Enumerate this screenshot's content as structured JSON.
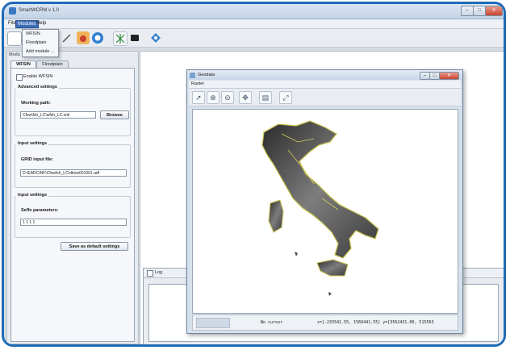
{
  "window": {
    "title": "SmartWCRM v 1.0"
  },
  "menubar": {
    "items": [
      "File",
      "Modules",
      "Help"
    ]
  },
  "modules_menu": {
    "items": [
      "WFSIN",
      "Floodplain",
      "Add module ..."
    ]
  },
  "left_panel": {
    "title": "Modu",
    "tabs": [
      "WFSIN",
      "Floodplain"
    ],
    "enable_label": "Enable WFSIN",
    "advanced": {
      "title": "Advanced settings",
      "working_path_label": "Working path:",
      "working_path_value": "Cfsw\\fsh_LC\\wfsh_LC.xml",
      "browse_label": "Browse"
    },
    "input1": {
      "title": "Input settings",
      "grid_label": "GRID input file:",
      "grid_value": "D:\\EARCINF\\Cfswfsh_LC\\dtmw001001.adf"
    },
    "input2": {
      "title": "Input settings",
      "params_label": "Seffe parameters:",
      "params_value": "1 1 1 1"
    },
    "save_label": "Save as default settings"
  },
  "geodata": {
    "title": "Geodata",
    "menu": "Raster",
    "status_cursor": "No cursor",
    "status_coords": "x=[-233541.55, 1569441.55] y=[3562431.00, 515563"
  },
  "log": {
    "title": "Log"
  },
  "colors": {
    "accent": "#1e6bb8",
    "menu_selected": "#3b6fb6",
    "close_button": "#c8442e"
  }
}
